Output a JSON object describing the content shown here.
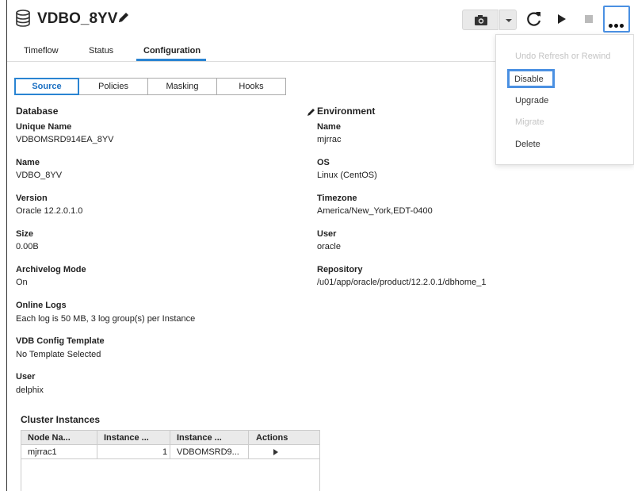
{
  "header": {
    "title": "VDBO_8YV",
    "icons": {
      "database": "database-icon",
      "edit": "pencil-icon",
      "snapshot": "camera-icon",
      "dropdown": "caret-down-icon",
      "refresh": "refresh-icon",
      "start": "play-icon",
      "stop": "stop-icon",
      "more": "more-icon"
    }
  },
  "tabs": [
    {
      "label": "Timeflow"
    },
    {
      "label": "Status"
    },
    {
      "label": "Configuration",
      "active": true
    }
  ],
  "subtabs": [
    {
      "label": "Source",
      "active": true
    },
    {
      "label": "Policies"
    },
    {
      "label": "Masking"
    },
    {
      "label": "Hooks"
    }
  ],
  "database": {
    "title": "Database",
    "fields": [
      {
        "label": "Unique Name",
        "value": "VDBOMSRD914EA_8YV"
      },
      {
        "label": "Name",
        "value": "VDBO_8YV"
      },
      {
        "label": "Version",
        "value": "Oracle 12.2.0.1.0"
      },
      {
        "label": "Size",
        "value": "0.00B"
      },
      {
        "label": "Archivelog Mode",
        "value": "On"
      },
      {
        "label": "Online Logs",
        "value": "Each log is 50 MB, 3 log group(s) per Instance"
      },
      {
        "label": "VDB Config Template",
        "value": "No Template Selected"
      },
      {
        "label": "User",
        "value": "delphix"
      }
    ]
  },
  "environment": {
    "title": "Environment",
    "fields": [
      {
        "label": "Name",
        "value": "mjrrac"
      },
      {
        "label": "OS",
        "value": "Linux (CentOS)"
      },
      {
        "label": "Timezone",
        "value": "America/New_York,EDT-0400"
      },
      {
        "label": "User",
        "value": "oracle"
      },
      {
        "label": "Repository",
        "value": "/u01/app/oracle/product/12.2.0.1/dbhome_1"
      }
    ]
  },
  "cluster": {
    "title": "Cluster Instances",
    "columns": [
      "Node Na...",
      "Instance ...",
      "Instance ...",
      "Actions"
    ],
    "rows": [
      {
        "node": "mjrrac1",
        "instance_number": "1",
        "instance_name": "VDBOMSRD9..."
      }
    ]
  },
  "menu": {
    "items": [
      {
        "label": "Undo Refresh or Rewind",
        "enabled": false
      },
      {
        "label": "Disable",
        "enabled": true,
        "highlighted": true
      },
      {
        "label": "Upgrade",
        "enabled": true
      },
      {
        "label": "Migrate",
        "enabled": false
      },
      {
        "label": "Delete",
        "enabled": true
      }
    ]
  },
  "colors": {
    "accent": "#2a84d2",
    "highlight": "#4a90e2",
    "disabled": "#c4c4c4"
  }
}
